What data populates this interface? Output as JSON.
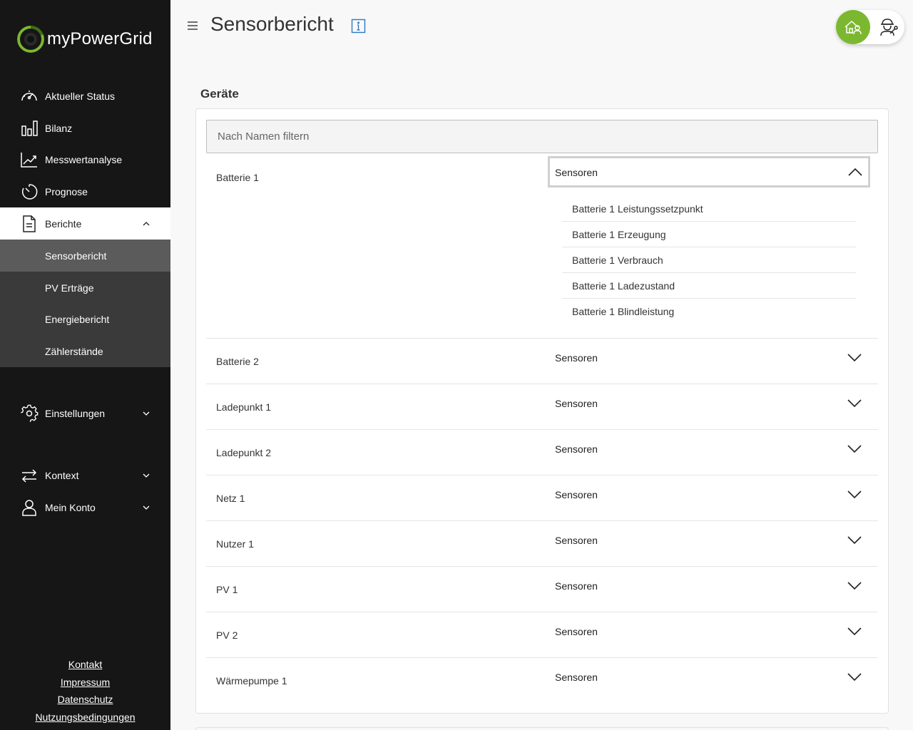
{
  "app": {
    "name": "myPowerGrid"
  },
  "sidebar": {
    "items": [
      {
        "label": "Aktueller Status",
        "icon": "gauge-icon"
      },
      {
        "label": "Bilanz",
        "icon": "bar-chart-icon"
      },
      {
        "label": "Messwertanalyse",
        "icon": "line-chart-icon"
      },
      {
        "label": "Prognose",
        "icon": "timer-icon"
      },
      {
        "label": "Berichte",
        "icon": "document-icon",
        "expanded": true
      }
    ],
    "sub_items": [
      {
        "label": "Sensorbericht",
        "active": true
      },
      {
        "label": "PV Erträge"
      },
      {
        "label": "Energiebericht"
      },
      {
        "label": "Zählerstände"
      }
    ],
    "settings": {
      "label": "Einstellungen",
      "icon": "gear-icon"
    },
    "context": {
      "label": "Kontext",
      "icon": "swap-arrows-icon"
    },
    "account": {
      "label": "Mein Konto",
      "icon": "user-icon"
    },
    "footer_links": [
      "Kontakt",
      "Impressum",
      "Datenschutz",
      "Nutzungsbedingungen"
    ]
  },
  "header": {
    "title": "Sensorbericht"
  },
  "colors": {
    "brand_green": "#7cb82f",
    "sidebar_bg": "#161616"
  },
  "main": {
    "section_title": "Geräte",
    "filter_placeholder": "Nach Namen filtern",
    "sensor_select_label": "Sensoren",
    "devices": [
      {
        "name": "Batterie 1",
        "expanded": true,
        "sensors": [
          "Batterie 1 Leistungssetzpunkt",
          "Batterie 1 Erzeugung",
          "Batterie 1 Verbrauch",
          "Batterie 1 Ladezustand",
          "Batterie 1 Blindleistung"
        ]
      },
      {
        "name": "Batterie 2"
      },
      {
        "name": "Ladepunkt 1"
      },
      {
        "name": "Ladepunkt 2"
      },
      {
        "name": "Netz 1"
      },
      {
        "name": "Nutzer 1"
      },
      {
        "name": "PV 1"
      },
      {
        "name": "PV 2"
      },
      {
        "name": "Wärmepumpe 1"
      }
    ]
  }
}
